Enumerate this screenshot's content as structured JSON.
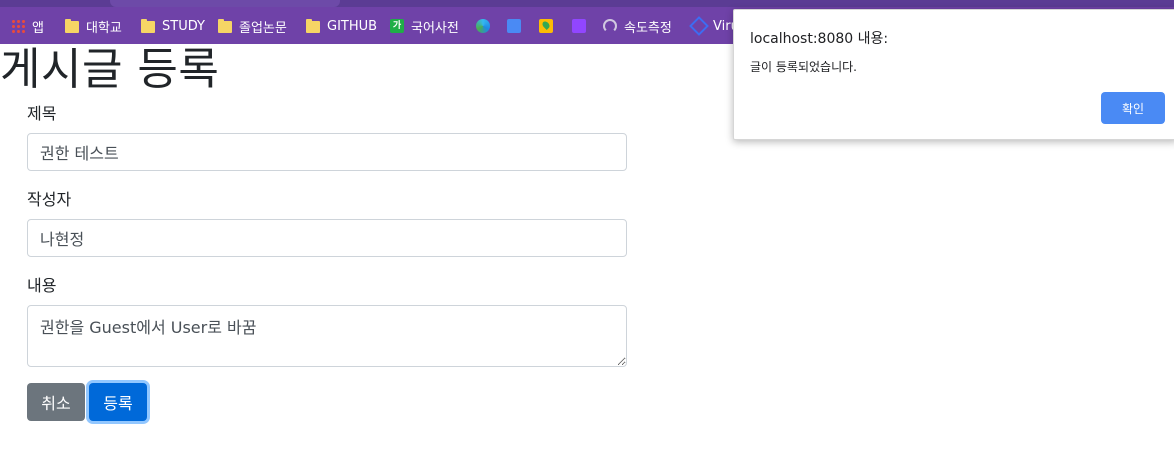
{
  "bookmarks": [
    {
      "label": "앱",
      "icon": "apps-icon"
    },
    {
      "label": "대학교",
      "icon": "folder-icon"
    },
    {
      "label": "STUDY",
      "icon": "folder-icon"
    },
    {
      "label": "졸업논문",
      "icon": "folder-icon"
    },
    {
      "label": "GITHUB",
      "icon": "folder-icon"
    },
    {
      "label": "국어사전",
      "icon": "dictionary-icon"
    },
    {
      "label": "",
      "icon": "edge-icon"
    },
    {
      "label": "",
      "icon": "google-translate-icon"
    },
    {
      "label": "",
      "icon": "maps-icon"
    },
    {
      "label": "",
      "icon": "twitch-icon"
    },
    {
      "label": "속도측정",
      "icon": "speedometer-icon"
    },
    {
      "label": "Viru",
      "icon": "virustotal-icon"
    }
  ],
  "page": {
    "title": "게시글 등록"
  },
  "form": {
    "title_label": "제목",
    "title_value": "권한 테스트",
    "writer_label": "작성자",
    "writer_value": "나현정",
    "content_label": "내용",
    "content_value": "권한을 Guest에서 User로 바꿈",
    "cancel_label": "취소",
    "submit_label": "등록"
  },
  "alert": {
    "title": "localhost:8080 내용:",
    "message": "글이 등록되었습니다.",
    "ok_label": "확인"
  },
  "colors": {
    "bookmarks_bar": "#6f42a8",
    "cancel_button": "#6c757d",
    "submit_button": "#0069d9",
    "alert_ok_button": "#4a8af4"
  }
}
